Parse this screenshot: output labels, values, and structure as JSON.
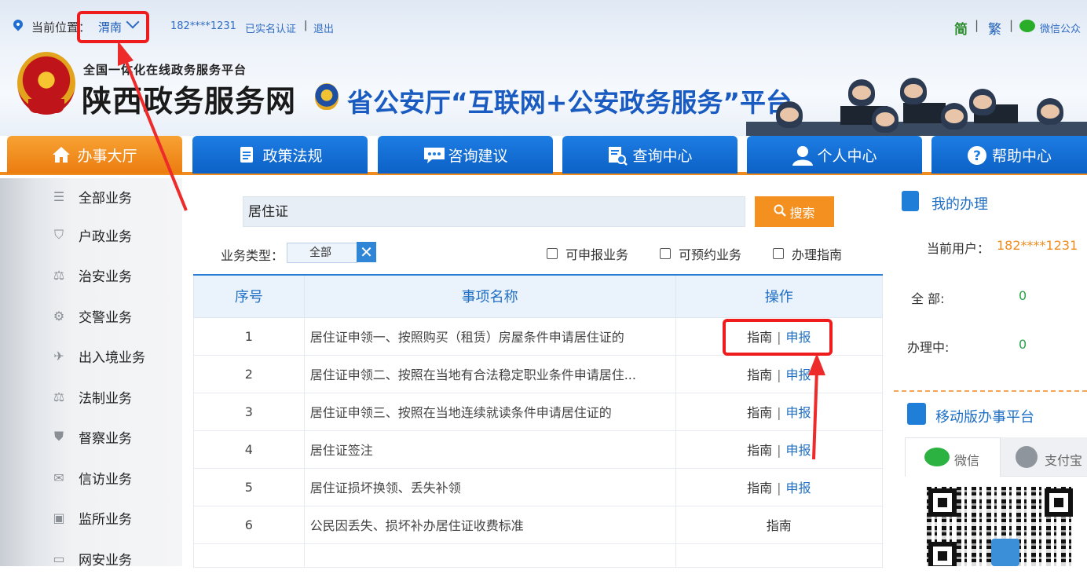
{
  "topbar": {
    "location_label": "当前位置：",
    "location_value": "渭南",
    "user_phone": "182****1231",
    "verified": "已实名认证",
    "sep": "|",
    "logout": "退出",
    "lang_simplified": "简",
    "lang_traditional": "繁",
    "wechat": "微信公众"
  },
  "brand": {
    "subtitle": "全国一体化在线政务服务平台",
    "title": "陕西政务服务网",
    "slogan": "省公安厅“互联网+公安政务服务”平台"
  },
  "nav": {
    "tabs": [
      {
        "label": "办事大厅",
        "icon": "home-icon"
      },
      {
        "label": "政策法规",
        "icon": "document-icon"
      },
      {
        "label": "咨询建议",
        "icon": "chat-icon"
      },
      {
        "label": "查询中心",
        "icon": "search-doc-icon"
      },
      {
        "label": "个人中心",
        "icon": "user-icon"
      },
      {
        "label": "帮助中心",
        "icon": "help-icon"
      }
    ]
  },
  "sidebar": {
    "items": [
      {
        "label": "全部业务",
        "icon": "list-icon"
      },
      {
        "label": "户政业务",
        "icon": "shield-icon"
      },
      {
        "label": "治安业务",
        "icon": "scales-icon"
      },
      {
        "label": "交警业务",
        "icon": "traffic-icon"
      },
      {
        "label": "出入境业务",
        "icon": "plane-icon"
      },
      {
        "label": "法制业务",
        "icon": "law-icon"
      },
      {
        "label": "督察业务",
        "icon": "badge-icon"
      },
      {
        "label": "信访业务",
        "icon": "mail-icon"
      },
      {
        "label": "监所业务",
        "icon": "building-icon"
      },
      {
        "label": "网安业务",
        "icon": "monitor-icon"
      }
    ]
  },
  "search": {
    "value": "居住证",
    "button": "搜索"
  },
  "filters": {
    "type_label": "业务类型：",
    "type_value": "全部",
    "clear": "✕",
    "options": [
      "可申报业务",
      "可预约业务",
      "办理指南"
    ]
  },
  "table": {
    "headers": [
      "序号",
      "事项名称",
      "操作"
    ],
    "rows": [
      {
        "no": "1",
        "name": "居住证申领一、按照购买（租赁）房屋条件申请居住证的",
        "guide": "指南",
        "apply": "申报"
      },
      {
        "no": "2",
        "name": "居住证申领二、按照在当地有合法稳定职业条件申请居住...",
        "guide": "指南",
        "apply": "申报"
      },
      {
        "no": "3",
        "name": "居住证申领三、按照在当地连续就读条件申请居住证的",
        "guide": "指南",
        "apply": "申报"
      },
      {
        "no": "4",
        "name": "居住证签注",
        "guide": "指南",
        "apply": "申报"
      },
      {
        "no": "5",
        "name": "居住证损坏换领、丢失补领",
        "guide": "指南",
        "apply": "申报"
      },
      {
        "no": "6",
        "name": "公民因丢失、损坏补办居住证收费标准",
        "guide": "指南",
        "apply": ""
      }
    ]
  },
  "right_panel": {
    "title": "我的办理",
    "current_user_label": "当前用户：",
    "current_user": "182****1231",
    "all_label": "全 部:",
    "all_count": "0",
    "in_progress_label": "办理中:",
    "in_progress_count": "0",
    "mobile_title": "移动版办事平台",
    "tab_wechat": "微信",
    "tab_alipay": "支付宝"
  },
  "colors": {
    "primary_blue": "#1d7de3",
    "active_orange": "#f08c1e",
    "annotation_red": "#ee1c1c"
  }
}
